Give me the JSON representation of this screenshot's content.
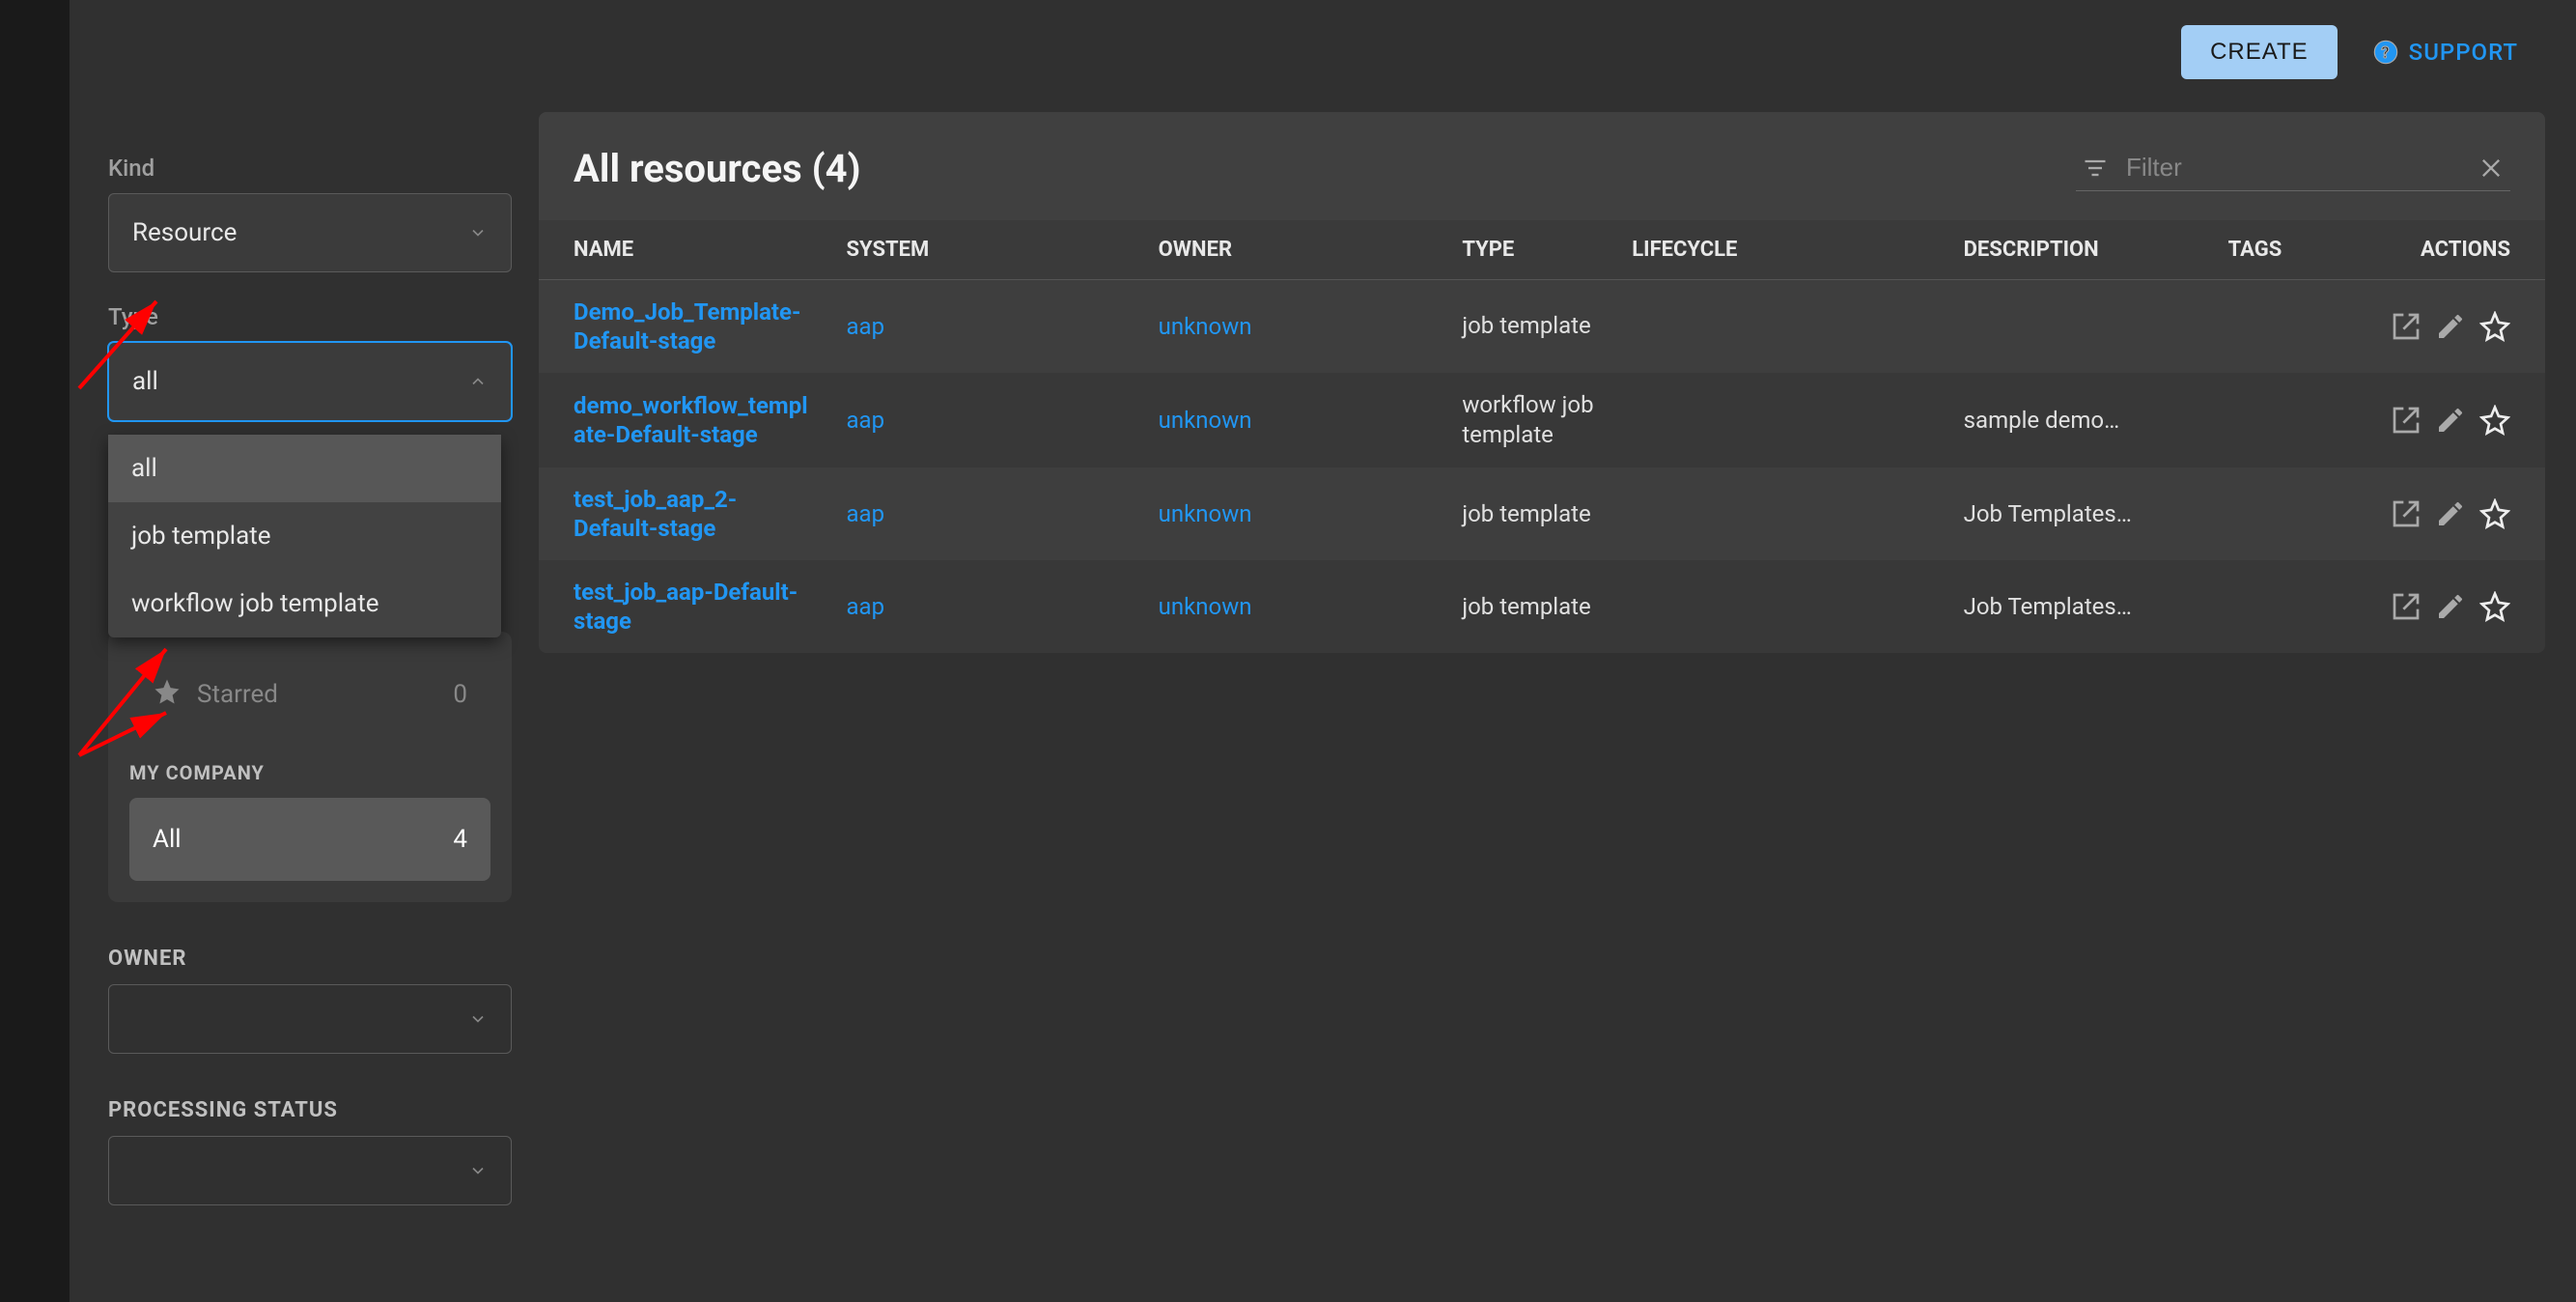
{
  "topbar": {
    "create_label": "CREATE",
    "support_label": "SUPPORT"
  },
  "sidebar": {
    "kind": {
      "label": "Kind",
      "value": "Resource"
    },
    "type": {
      "label": "Type",
      "value": "all",
      "options": [
        {
          "label": "all",
          "selected": true
        },
        {
          "label": "job template",
          "selected": false
        },
        {
          "label": "workflow job template",
          "selected": false
        }
      ]
    },
    "starred_block": {
      "starred_label": "Starred",
      "starred_count": "0"
    },
    "my_company": {
      "header": "MY COMPANY",
      "all_label": "All",
      "all_count": "4"
    },
    "owner": {
      "label": "OWNER",
      "value": ""
    },
    "processing_status": {
      "label": "PROCESSING STATUS",
      "value": ""
    }
  },
  "content": {
    "title": "All resources (4)",
    "filter_placeholder": "Filter",
    "columns": {
      "name": "NAME",
      "system": "SYSTEM",
      "owner": "OWNER",
      "type": "TYPE",
      "lifecycle": "LIFECYCLE",
      "description": "DESCRIPTION",
      "tags": "TAGS",
      "actions": "ACTIONS"
    },
    "rows": [
      {
        "name": "Demo_Job_Template-Default-stage",
        "system": "aap",
        "owner": "unknown",
        "type": "job template",
        "lifecycle": "",
        "description": "",
        "tags": ""
      },
      {
        "name": "demo_workflow_template-Default-stage",
        "system": "aap",
        "owner": "unknown",
        "type": "workflow job template",
        "lifecycle": "",
        "description": "sample demo…",
        "tags": ""
      },
      {
        "name": "test_job_aap_2-Default-stage",
        "system": "aap",
        "owner": "unknown",
        "type": "job template",
        "lifecycle": "",
        "description": "Job Templates…",
        "tags": ""
      },
      {
        "name": "test_job_aap-Default-stage",
        "system": "aap",
        "owner": "unknown",
        "type": "job template",
        "lifecycle": "",
        "description": "Job Templates…",
        "tags": ""
      }
    ]
  }
}
